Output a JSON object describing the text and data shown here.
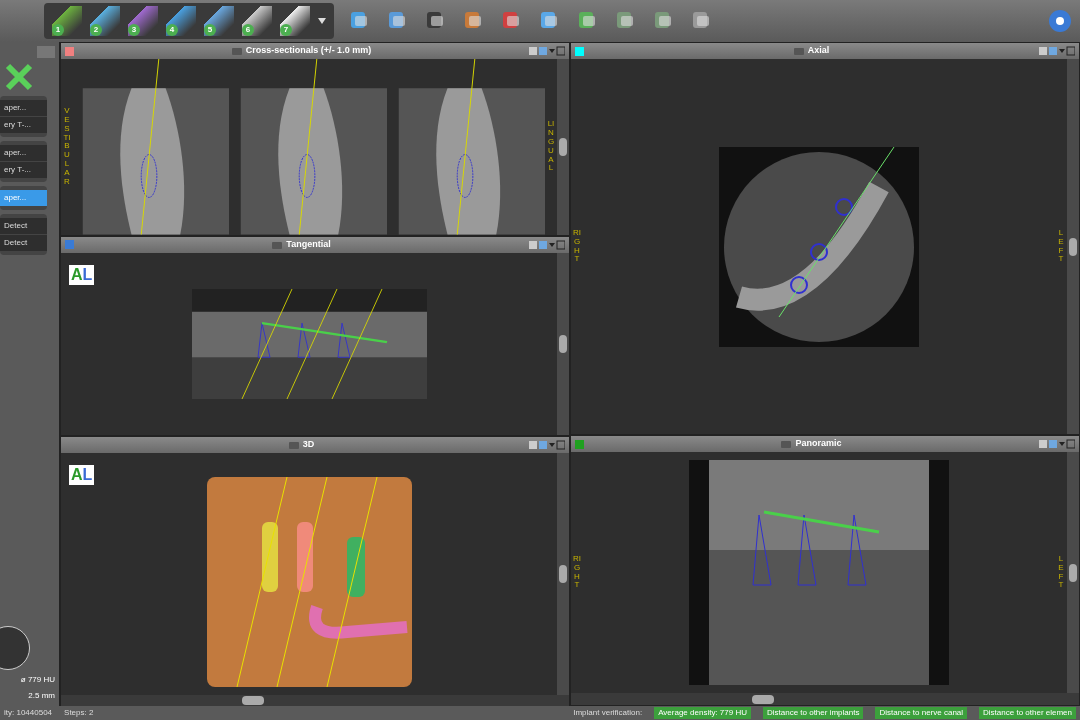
{
  "toolbar": {
    "step_buttons": [
      "1",
      "2",
      "3",
      "4",
      "5",
      "6",
      "7"
    ]
  },
  "left_panel": {
    "groups": [
      {
        "items": [
          {
            "label": "aper...",
            "selected": false
          },
          {
            "label": "ery T-...",
            "selected": false
          }
        ]
      },
      {
        "items": [
          {
            "label": "aper...",
            "selected": false
          },
          {
            "label": "ery T-...",
            "selected": false
          }
        ]
      },
      {
        "items": [
          {
            "label": "aper...",
            "selected": true
          }
        ]
      },
      {
        "items": [
          {
            "label": "Detect",
            "selected": false
          },
          {
            "label": "Detect",
            "selected": false
          }
        ]
      }
    ],
    "density": "ø 779 HU",
    "diameter": "2.5 mm"
  },
  "views": [
    {
      "kind": "cross",
      "title": "Cross-sectionals (+/- 1.0 mm)",
      "color": "#f08080",
      "side_labels": [
        "VESTIBULAR",
        "LINGUAL"
      ]
    },
    {
      "kind": "tangential",
      "title": "Tangential",
      "color": "#3a7bd5",
      "badge": [
        "A",
        "L"
      ]
    },
    {
      "kind": "model",
      "title": "3D",
      "badge": [
        "A",
        "L"
      ]
    },
    {
      "kind": "axial",
      "title": "Axial",
      "color": "#00ffff",
      "side_labels": [
        "RIGHT",
        "LEFT"
      ]
    },
    {
      "kind": "panoramic",
      "title": "Panoramic",
      "color": "#20a020",
      "side_labels": [
        "RIGHT",
        "LEFT"
      ]
    }
  ],
  "status_bar": {
    "left": [
      "ity: 10440504",
      "Steps: 2"
    ],
    "verification_label": "Implant verification:",
    "checks": [
      "Average density: 779 HU",
      "Distance to other implants",
      "Distance to nerve canal",
      "Distance to other elemen"
    ]
  }
}
